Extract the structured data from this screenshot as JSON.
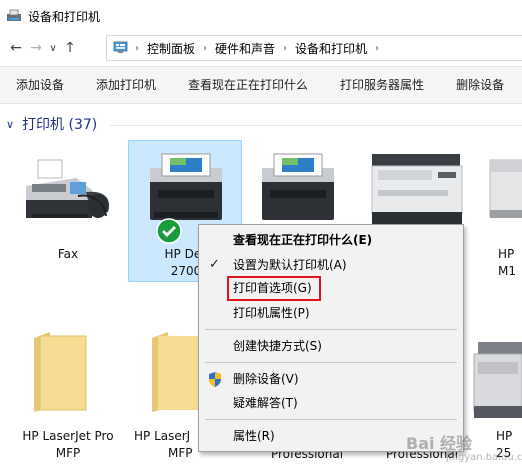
{
  "window": {
    "title": "设备和打印机"
  },
  "nav": {
    "back": "←",
    "forward": "→",
    "history": "∨",
    "up": "↑",
    "breadcrumbs": [
      "控制面板",
      "硬件和声音",
      "设备和打印机"
    ]
  },
  "toolbar": {
    "items": [
      "添加设备",
      "添加打印机",
      "查看现在正在打印什么",
      "打印服务器属性",
      "删除设备"
    ]
  },
  "group": {
    "label": "打印机 (37)"
  },
  "devices": [
    {
      "line1": "Fax",
      "line2": ""
    },
    {
      "line1": "HP Des",
      "line2": "2700"
    },
    {
      "line1": "HP",
      "line2": "M1"
    },
    {
      "line1": "HP LaserJet Pro",
      "line2": "MFP"
    },
    {
      "line1": "HP LaserJ",
      "line2": "MFP"
    },
    {
      "line1": "",
      "line2": "Professional"
    },
    {
      "line1": "",
      "line2": "Professional"
    },
    {
      "line1": "HP",
      "line2": "25"
    }
  ],
  "context_menu": {
    "items": [
      {
        "label": "查看现在正在打印什么(E)"
      },
      {
        "label": "设置为默认打印机(A)"
      },
      {
        "label": "打印首选项(G)"
      },
      {
        "label": "打印机属性(P)"
      },
      {
        "label": "创建快捷方式(S)"
      },
      {
        "label": "删除设备(V)"
      },
      {
        "label": "疑难解答(T)"
      },
      {
        "label": "属性(R)"
      }
    ]
  },
  "watermark": {
    "text": "Bai 经验",
    "sub": "jingyan.baidu.com"
  },
  "colors": {
    "selection": "#cce8ff",
    "highlight_box": "#e0141b",
    "group_header": "#1e3287",
    "default_check": "#1a9b3e"
  }
}
